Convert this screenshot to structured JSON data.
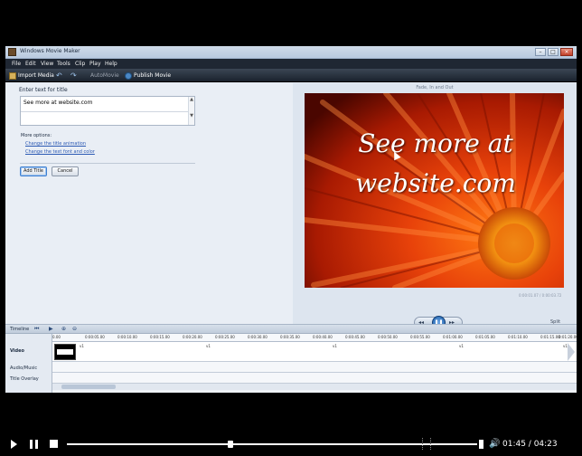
{
  "window": {
    "title": "Windows Movie Maker"
  },
  "menu": [
    "File",
    "Edit",
    "View",
    "Tools",
    "Clip",
    "Play",
    "Help"
  ],
  "toolbar": {
    "import": "Import Media",
    "automovie": "AutoMovie",
    "publish": "Publish Movie"
  },
  "task_pane": {
    "prompt": "Enter text for title",
    "title_value": "See more at website.com",
    "more_options": "More options:",
    "link_animation": "Change the title animation",
    "link_font": "Change the text font and color",
    "add_button": "Add Title",
    "cancel_button": "Cancel"
  },
  "preview": {
    "effect": "Fade, In and Out",
    "caption": "See more at website.com",
    "time_readout": "0:00:01.07 / 0:00:03.72",
    "seek_fraction": 0.4,
    "split_label": "Split"
  },
  "timeline": {
    "label": "Timeline",
    "tracks": {
      "video": "Video",
      "audio": "Audio/Music",
      "overlay": "Title Overlay"
    },
    "ruler": [
      "0.00",
      "0:00:05.00",
      "0:00:10.00",
      "0:00:15.00",
      "0:00:20.00",
      "0:00:25.00",
      "0:00:30.00",
      "0:00:35.00",
      "0:00:40.00",
      "0:00:45.00",
      "0:00:50.00",
      "0:00:55.00",
      "0:01:00.00",
      "0:01:05.00",
      "0:01:10.00",
      "0:01:15.00",
      "0:01:20.00"
    ],
    "clip_marks": [
      "v1",
      "v1",
      "v1",
      "v1",
      "v1"
    ]
  },
  "player": {
    "time": "01:45 / 04:23",
    "progress_fraction": 0.399,
    "volume_fraction": 0.98
  },
  "colors": {
    "accent": "#4b87c4",
    "seek_green": "#3dbb3d",
    "link": "#2b59b3"
  }
}
